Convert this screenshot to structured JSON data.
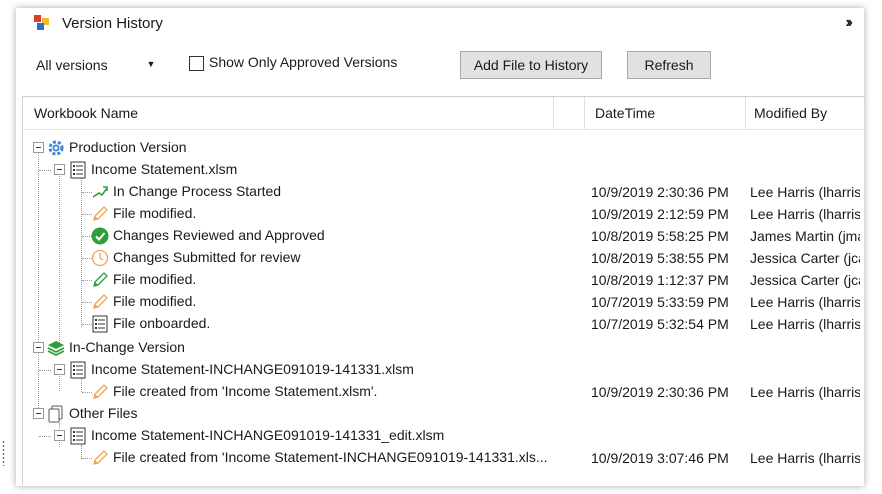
{
  "window": {
    "title": "Version History",
    "collapse_icon": "double-chevron-right-icon"
  },
  "toolbar": {
    "versions_select": "All versions",
    "show_approved_label": "Show Only Approved Versions",
    "show_approved_checked": false,
    "add_file_label": "Add File to History",
    "refresh_label": "Refresh"
  },
  "columns": {
    "name": "Workbook Name",
    "datetime": "DateTime",
    "modified_by": "Modified By"
  },
  "tree": {
    "production": {
      "label": "Production Version",
      "icon": "gear-icon",
      "file": {
        "label": "Income Statement.xlsm",
        "entries": [
          {
            "label": "In Change Process Started",
            "icon": "trend-arrow-icon",
            "datetime": "10/9/2019 2:30:36 PM",
            "by": "Lee Harris (lharris)"
          },
          {
            "label": "File modified.",
            "icon": "pencil-orange-icon",
            "datetime": "10/9/2019 2:12:59 PM",
            "by": "Lee Harris (lharris)"
          },
          {
            "label": "Changes Reviewed and Approved",
            "icon": "check-circle-icon",
            "datetime": "10/8/2019 5:58:25 PM",
            "by": "James Martin (jmartin)"
          },
          {
            "label": "Changes Submitted for review",
            "icon": "clock-icon",
            "datetime": "10/8/2019 5:38:55 PM",
            "by": "Jessica Carter (jcarter)"
          },
          {
            "label": "File modified.",
            "icon": "pencil-green-icon",
            "datetime": "10/8/2019 1:12:37 PM",
            "by": "Jessica Carter (jcarter)"
          },
          {
            "label": "File modified.",
            "icon": "pencil-orange-icon",
            "datetime": "10/7/2019 5:33:59 PM",
            "by": "Lee Harris (lharris)"
          },
          {
            "label": "File onboarded.",
            "icon": "list-doc-icon",
            "datetime": "10/7/2019 5:32:54 PM",
            "by": "Lee Harris (lharris)"
          }
        ]
      }
    },
    "inchange": {
      "label": "In-Change Version",
      "icon": "layers-icon",
      "file": {
        "label": "Income Statement-INCHANGE091019-141331.xlsm",
        "entries": [
          {
            "label": "File created from 'Income Statement.xlsm'.",
            "icon": "pencil-orange-icon",
            "datetime": "10/9/2019 2:30:36 PM",
            "by": "Lee Harris (lharris)"
          }
        ]
      }
    },
    "other": {
      "label": "Other Files",
      "icon": "documents-icon",
      "file": {
        "label": "Income Statement-INCHANGE091019-141331_edit.xlsm",
        "entries": [
          {
            "label": "File created from 'Income Statement-INCHANGE091019-141331.xls...",
            "icon": "pencil-orange-icon",
            "datetime": "10/9/2019 3:07:46 PM",
            "by": "Lee Harris (lharris)"
          }
        ]
      }
    }
  },
  "colors": {
    "accent_blue": "#3b86d6",
    "green": "#2e9e3c",
    "orange": "#f0a25a"
  }
}
